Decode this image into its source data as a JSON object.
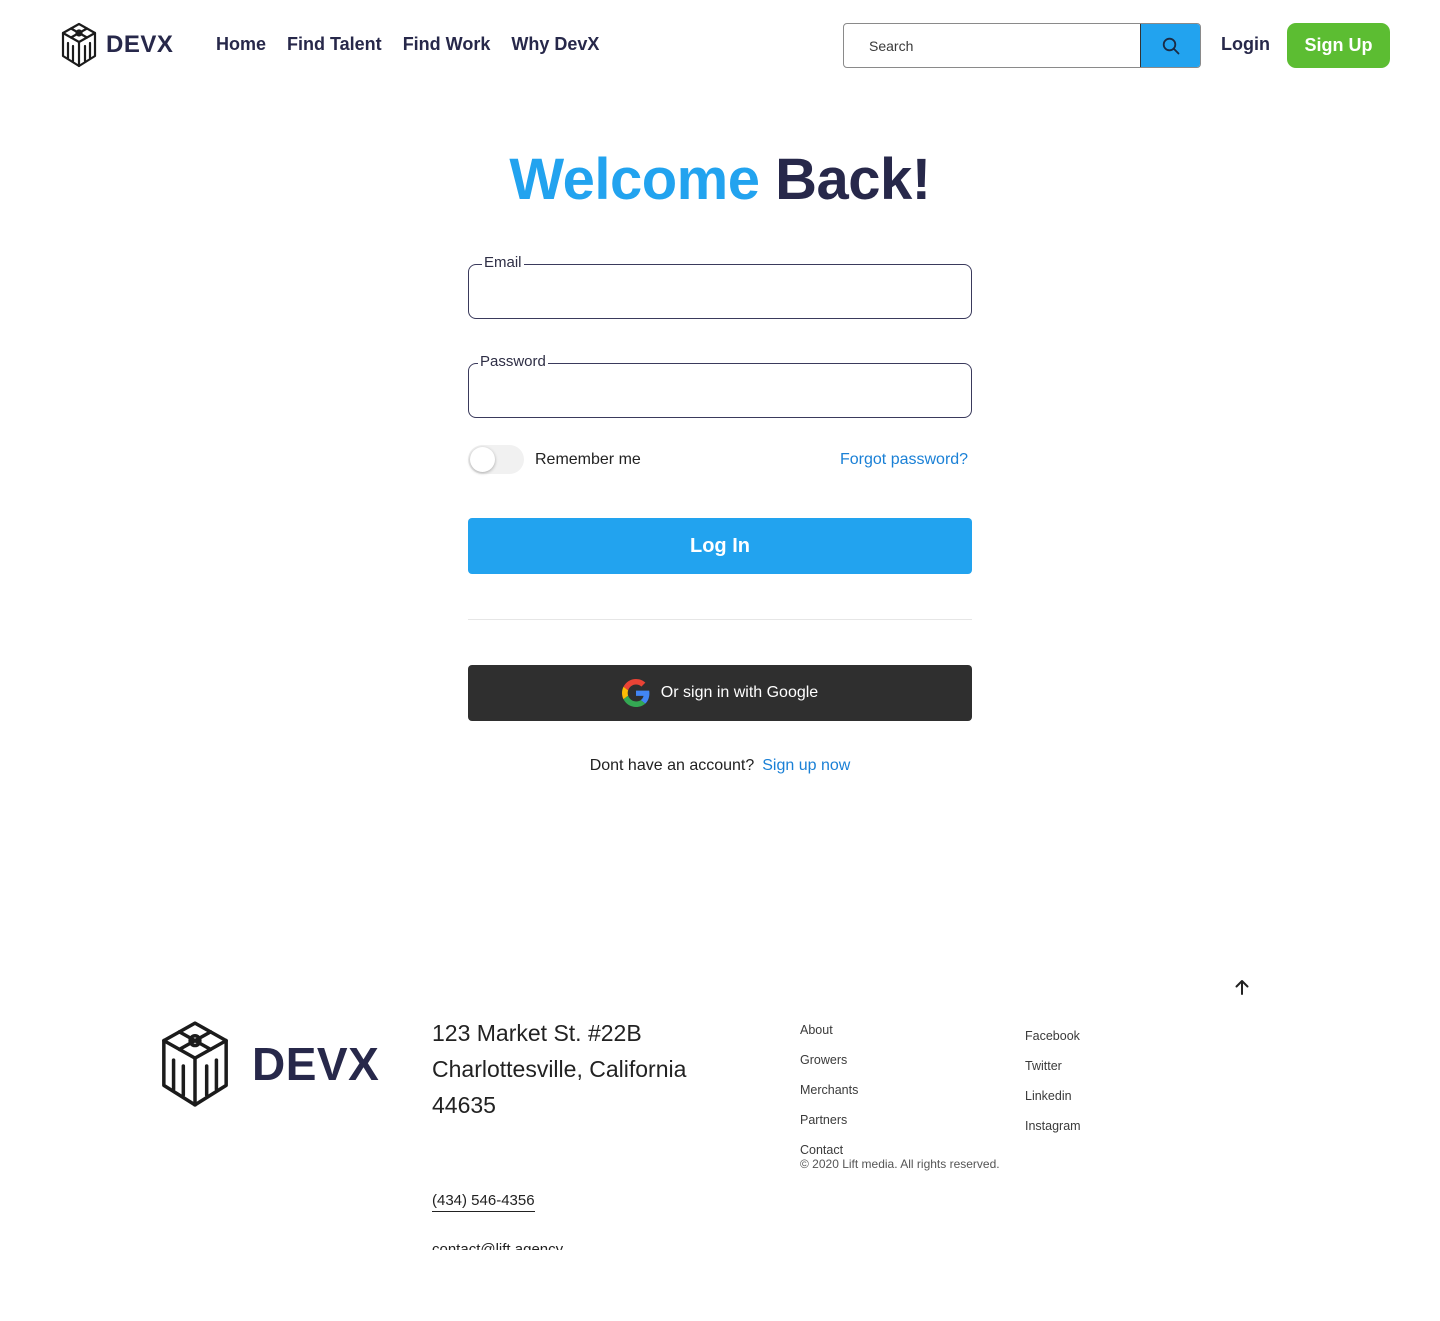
{
  "header": {
    "brand": "DEVX",
    "nav": [
      {
        "label": "Home"
      },
      {
        "label": "Find Talent"
      },
      {
        "label": "Find Work"
      },
      {
        "label": "Why DevX"
      }
    ],
    "search": {
      "placeholder": "Search",
      "value": ""
    },
    "login_label": "Login",
    "signup_label": "Sign Up"
  },
  "main": {
    "title_accent": "Welcome",
    "title_rest": "Back!",
    "email": {
      "label": "Email",
      "value": ""
    },
    "password": {
      "label": "Password",
      "value": ""
    },
    "remember_label": "Remember me",
    "remember_checked": false,
    "forgot_label": "Forgot password?",
    "login_button": "Log In",
    "google_button": "Or sign in with Google",
    "signup_prompt": "Dont have an account?",
    "signup_link": "Sign up now"
  },
  "footer": {
    "brand": "DEVX",
    "address": [
      "123 Market St. #22B",
      "Charlottesville, California",
      "44635"
    ],
    "phone": "(434) 546-4356",
    "email": "contact@lift.agency",
    "links_col1": [
      "About",
      "Growers",
      "Merchants",
      "Partners",
      "Contact"
    ],
    "links_col2": [
      "Facebook",
      "Twitter",
      "Linkedin",
      "Instagram"
    ],
    "copyright": "© 2020 Lift media. All rights reserved."
  },
  "colors": {
    "accent": "#22a3ef",
    "brand_dark": "#27284a",
    "signup_green": "#5cbd32",
    "google_dark": "#2f2f2f",
    "link_blue": "#1a80d6"
  },
  "icons": [
    "devx-logo-icon",
    "search-icon",
    "google-icon",
    "arrow-up-icon"
  ]
}
